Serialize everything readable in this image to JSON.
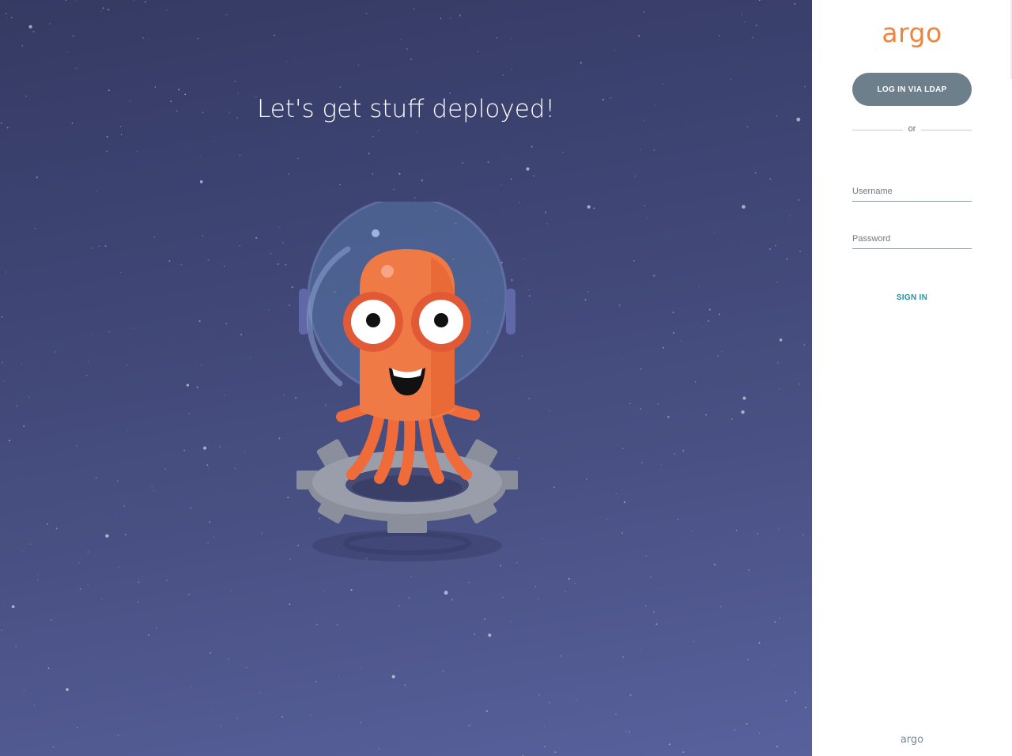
{
  "hero": {
    "tagline": "Let's get stuff deployed!",
    "background_color": "#3f4675",
    "mascot": "argo-octopus-astronaut"
  },
  "login_panel": {
    "logo_text": "argo",
    "brand_color": "#f0843c",
    "ldap_button_label": "LOG IN VIA LDAP",
    "divider_text": "or",
    "username": {
      "placeholder": "Username",
      "value": ""
    },
    "password": {
      "placeholder": "Password",
      "value": ""
    },
    "sign_in_label": "SIGN IN",
    "sign_in_color": "#1e95a8",
    "footer_logo_text": "argo"
  }
}
